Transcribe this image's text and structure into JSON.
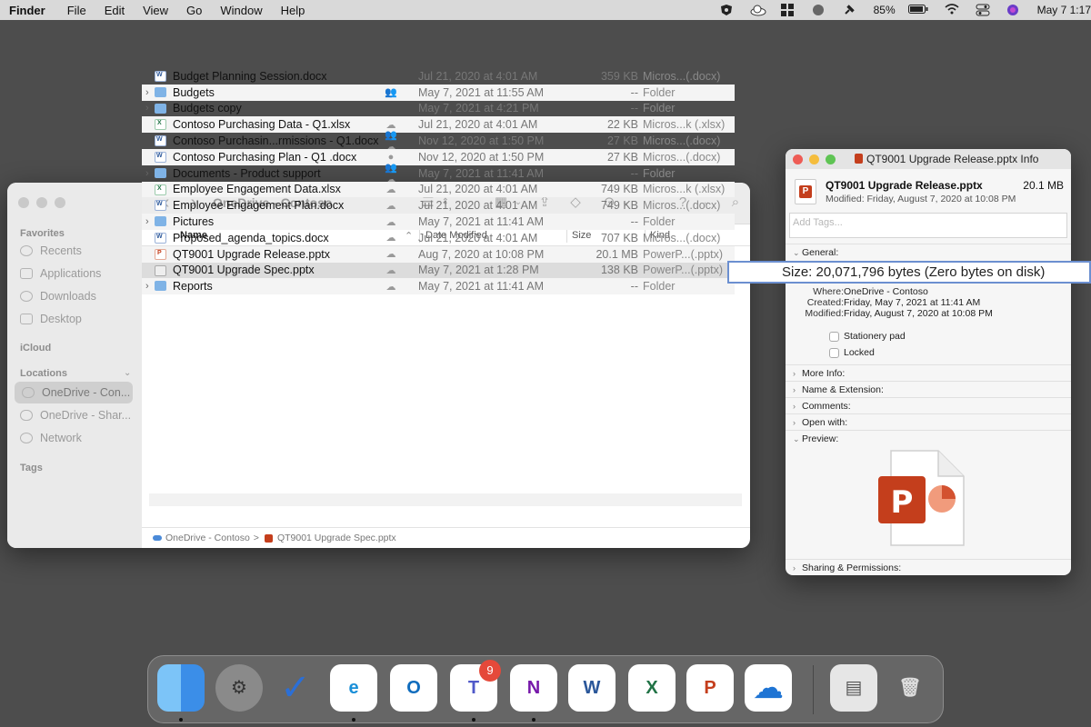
{
  "menubar": {
    "app": "Finder",
    "menus": [
      "File",
      "Edit",
      "View",
      "Go",
      "Window",
      "Help"
    ],
    "battery": "85%",
    "clock": "May 7  1:17",
    "icons": [
      "malwarebytes-icon",
      "cloud-icon",
      "windows-icon",
      "vpn-icon",
      "pin-icon",
      "battery-icon",
      "wifi-icon",
      "control-center-icon",
      "siri-icon"
    ]
  },
  "finder": {
    "title": "OneDrive - Contoso",
    "sidebar": {
      "favorites_label": "Favorites",
      "favorites": [
        "Recents",
        "Applications",
        "Downloads",
        "Desktop"
      ],
      "icloud_label": "iCloud",
      "locations_label": "Locations",
      "locations": [
        "OneDrive - Con...",
        "OneDrive - Shar...",
        "Network"
      ],
      "tags_label": "Tags"
    },
    "columns": {
      "name": "Name",
      "date": "Date Modified",
      "size": "Size",
      "kind": "Kind"
    },
    "rows": [
      {
        "name": "Budget Planning Session.docx",
        "date": "Jul 21, 2020 at 4:01 AM",
        "size": "359 KB",
        "kind": "Micros...(.docx)",
        "type": "word",
        "status": "",
        "folder": false
      },
      {
        "name": "Budgets",
        "date": "May 7, 2021 at 11:55 AM",
        "size": "--",
        "kind": "Folder",
        "type": "folder",
        "status": "shared",
        "folder": true
      },
      {
        "name": "Budgets copy",
        "date": "May 7, 2021 at 4:21 PM",
        "size": "--",
        "kind": "Folder",
        "type": "folder",
        "status": "",
        "folder": true
      },
      {
        "name": "Contoso Purchasing Data - Q1.xlsx",
        "date": "Jul 21, 2020 at 4:01 AM",
        "size": "22 KB",
        "kind": "Micros...k (.xlsx)",
        "type": "excel",
        "status": "cloud",
        "folder": false
      },
      {
        "name": "Contoso Purchasin...rmissions - Q1.docx",
        "date": "Nov 12, 2020 at 1:50 PM",
        "size": "27 KB",
        "kind": "Micros...(.docx)",
        "type": "word",
        "status": "shared-cloud",
        "folder": false
      },
      {
        "name": "Contoso Purchasing Plan - Q1 .docx",
        "date": "Nov 12, 2020 at 1:50 PM",
        "size": "27 KB",
        "kind": "Micros...(.docx)",
        "type": "word",
        "status": "synced",
        "folder": false
      },
      {
        "name": "Documents - Product support",
        "date": "May 7, 2021 at 11:41 AM",
        "size": "--",
        "kind": "Folder",
        "type": "folder",
        "status": "shared-cloud",
        "folder": true
      },
      {
        "name": "Employee Engagement Data.xlsx",
        "date": "Jul 21, 2020 at 4:01 AM",
        "size": "749 KB",
        "kind": "Micros...k (.xlsx)",
        "type": "excel",
        "status": "cloud",
        "folder": false
      },
      {
        "name": "Employee Engagement Plan.docx",
        "date": "Jul 21, 2020 at 4:01 AM",
        "size": "749 KB",
        "kind": "Micros...(.docx)",
        "type": "word",
        "status": "cloud",
        "folder": false
      },
      {
        "name": "Pictures",
        "date": "May 7, 2021 at 11:41 AM",
        "size": "--",
        "kind": "Folder",
        "type": "folder",
        "status": "cloud",
        "folder": true
      },
      {
        "name": "Proposed_agenda_topics.docx",
        "date": "Jul 21, 2020 at 4:01 AM",
        "size": "707 KB",
        "kind": "Micros...(.docx)",
        "type": "word",
        "status": "cloud",
        "folder": false
      },
      {
        "name": "QT9001 Upgrade Release.pptx",
        "date": "Aug 7, 2020 at 10:08 PM",
        "size": "20.1 MB",
        "kind": "PowerP...(.pptx)",
        "type": "ppt",
        "status": "cloud",
        "folder": false
      },
      {
        "name": "QT9001 Upgrade Spec.pptx",
        "date": "May 7, 2021 at 1:28 PM",
        "size": "138 KB",
        "kind": "PowerP...(.pptx)",
        "type": "ppt-gray",
        "status": "cloud",
        "folder": false,
        "selected": true
      },
      {
        "name": "Reports",
        "date": "May 7, 2021 at 11:41 AM",
        "size": "--",
        "kind": "Folder",
        "type": "folder",
        "status": "cloud",
        "folder": true
      }
    ],
    "path": {
      "root": "OneDrive - Contoso",
      "sep": ">",
      "file": "QT9001 Upgrade Spec.pptx"
    }
  },
  "info": {
    "title": "QT9001 Upgrade Release.pptx Info",
    "name": "QT9001 Upgrade Release.pptx",
    "size": "20.1 MB",
    "modified_line": "Modified: Friday, August 7, 2020 at 10:08 PM",
    "tags_placeholder": "Add Tags...",
    "general_label": "General:",
    "kv": [
      {
        "k": "Where:",
        "v": "OneDrive - Contoso"
      },
      {
        "k": "Created:",
        "v": "Friday, May 7, 2021 at 11:41 AM"
      },
      {
        "k": "Modified:",
        "v": "Friday, August 7, 2020 at 10:08 PM"
      }
    ],
    "stationery": "Stationery pad",
    "locked": "Locked",
    "sections": [
      "More Info:",
      "Name & Extension:",
      "Comments:",
      "Open with:"
    ],
    "preview_label": "Preview:",
    "sharing_label": "Sharing & Permissions:"
  },
  "tooltip": {
    "text": "Size: 20,071,796 bytes (Zero bytes on disk)"
  },
  "dock": {
    "teams_badge": "9",
    "apps": [
      {
        "name": "finder",
        "color": "#3b9cf2",
        "glyph": ""
      },
      {
        "name": "system-preferences",
        "color": "#8a8a8a",
        "glyph": "⚙"
      },
      {
        "name": "todo",
        "color": "transparent",
        "glyph": "✓"
      },
      {
        "name": "edge",
        "color": "#ffffff",
        "glyph": "e"
      },
      {
        "name": "outlook",
        "color": "#ffffff",
        "glyph": "O"
      },
      {
        "name": "teams",
        "color": "#ffffff",
        "glyph": "T"
      },
      {
        "name": "onenote",
        "color": "#ffffff",
        "glyph": "N"
      },
      {
        "name": "word",
        "color": "#ffffff",
        "glyph": "W"
      },
      {
        "name": "excel",
        "color": "#ffffff",
        "glyph": "X"
      },
      {
        "name": "powerpoint",
        "color": "#ffffff",
        "glyph": "P"
      },
      {
        "name": "onedrive",
        "color": "#ffffff",
        "glyph": "☁"
      },
      {
        "name": "printer",
        "color": "#e6e6e6",
        "glyph": "▤"
      },
      {
        "name": "trash",
        "color": "transparent",
        "glyph": "🗑"
      }
    ]
  },
  "colors": {
    "word": "#2b579a",
    "excel": "#217346",
    "ppt": "#c43e1c",
    "onenote": "#7719aa",
    "teams": "#5059c9",
    "outlook": "#0f6cbd"
  }
}
